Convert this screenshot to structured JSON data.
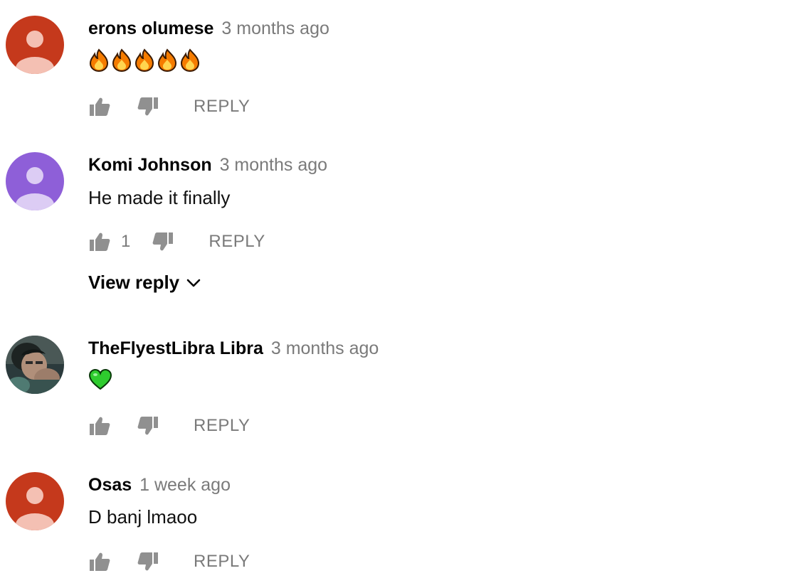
{
  "comments": [
    {
      "author": "erons olumese",
      "time": "3 months ago",
      "text": "",
      "emoji": [
        "fire-emoji",
        "fire-emoji",
        "fire-emoji",
        "fire-emoji",
        "fire-emoji"
      ],
      "likes": "",
      "avatar": {
        "type": "default",
        "bg": "#c5391c",
        "fg": "#f4c0b3"
      },
      "reply_label": "REPLY"
    },
    {
      "author": "Komi Johnson",
      "time": "3 months ago",
      "text": "He made it finally",
      "likes": "1",
      "avatar": {
        "type": "default",
        "bg": "#8e5fd8",
        "fg": "#dcccf4"
      },
      "reply_label": "REPLY",
      "view_reply_label": "View reply"
    },
    {
      "author": "TheFlyestLibra Libra",
      "time": "3 months ago",
      "text": "",
      "emoji": [
        "green-heart-emoji"
      ],
      "likes": "",
      "avatar": {
        "type": "photo"
      },
      "reply_label": "REPLY"
    },
    {
      "author": "Osas",
      "time": "1 week ago",
      "text": "D banj lmaoo",
      "likes": "",
      "avatar": {
        "type": "default",
        "bg": "#c5391c",
        "fg": "#f4c0b3"
      },
      "reply_label": "REPLY"
    }
  ],
  "icons": {
    "like": "thumbs-up-icon",
    "dislike": "thumbs-down-icon",
    "chevron": "chevron-down-icon"
  },
  "colors": {
    "meta_gray": "#7a7a7a",
    "text_dark": "#030303",
    "icon_gray": "#909090"
  }
}
